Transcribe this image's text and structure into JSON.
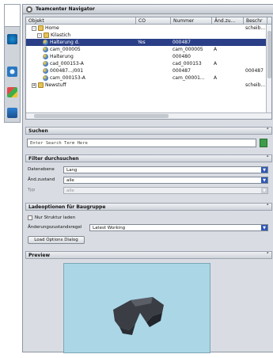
{
  "window": {
    "title": "Teamcenter Navigator"
  },
  "columns": [
    "Objekt",
    "CO",
    "Nummer",
    "Änd.zu...",
    "Beschr"
  ],
  "tree_rows": [
    {
      "indent": 1,
      "icon": "folder",
      "expander": "-",
      "name": "Home",
      "co": "",
      "nummer": "",
      "aend": "",
      "beschr": "scheib..."
    },
    {
      "indent": 2,
      "icon": "folder",
      "expander": "-",
      "name": "Kilastich",
      "co": "",
      "nummer": "",
      "aend": "",
      "beschr": ""
    },
    {
      "indent": 3,
      "icon": "item",
      "expander": "",
      "name": "Halterung d.",
      "co": "Yes",
      "nummer": "000487",
      "aend": "",
      "beschr": "",
      "selected": true
    },
    {
      "indent": 3,
      "icon": "item",
      "expander": "",
      "name": "cam_000005",
      "co": "",
      "nummer": "cam_000005",
      "aend": "A",
      "beschr": ""
    },
    {
      "indent": 3,
      "icon": "item",
      "expander": "",
      "name": "Halterung",
      "co": "",
      "nummer": "000480",
      "aend": "",
      "beschr": ""
    },
    {
      "indent": 3,
      "icon": "item",
      "expander": "",
      "name": "cad_000153-A",
      "co": "",
      "nummer": "cad_000153",
      "aend": "A",
      "beschr": ""
    },
    {
      "indent": 3,
      "icon": "item",
      "expander": "",
      "name": "000487.../001",
      "co": "",
      "nummer": "000487",
      "aend": "",
      "beschr": "000487"
    },
    {
      "indent": 3,
      "icon": "item",
      "expander": "",
      "name": "cam_000153-A",
      "co": "",
      "nummer": "cam_00001...",
      "aend": "A",
      "beschr": ""
    },
    {
      "indent": 1,
      "icon": "folder",
      "expander": "+",
      "name": "Newstuff",
      "co": "",
      "nummer": "",
      "aend": "",
      "beschr": "scheib..."
    }
  ],
  "search": {
    "title": "Suchen",
    "placeholder": "Enter Search Term Here"
  },
  "filter": {
    "title": "Filter durchsuchen",
    "rows": [
      {
        "label": "Datenebene",
        "value": "Lang"
      },
      {
        "label": "Änd.zustand",
        "value": "alle"
      },
      {
        "label": "Typ",
        "value": "alle"
      }
    ]
  },
  "load": {
    "title": "Ladeoptionen für Baugruppe",
    "checkbox_label": "Nur Struktur laden",
    "rule_label": "Änderungszustandsregel",
    "rule_value": "Latest Working",
    "button": "Load Options Dialog"
  },
  "preview": {
    "title": "Preview"
  }
}
